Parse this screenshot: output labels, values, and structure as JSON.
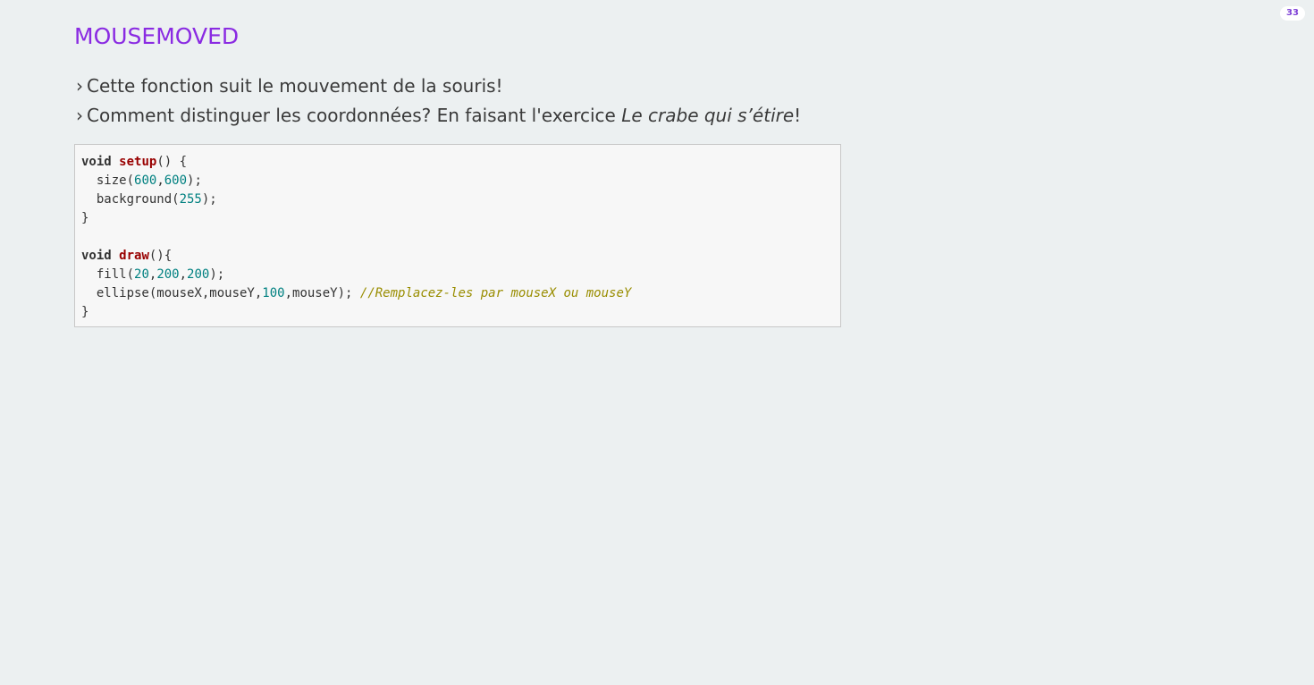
{
  "slide": {
    "page_number": "33",
    "title": "MOUSEMOVED",
    "bullets": [
      {
        "marker": "›",
        "text": "Cette fonction suit le mouvement de la souris!"
      },
      {
        "marker": "›",
        "text_before": "Comment distinguer les coordonnées? En faisant l'exercice ",
        "text_emphasis": "Le crabe qui s’étire",
        "text_after": "!"
      }
    ]
  },
  "code": {
    "l1_kw": "void",
    "l1_fn": "setup",
    "l1_rest": "() {",
    "l2_a": "  size(",
    "l2_n1": "600",
    "l2_b": ",",
    "l2_n2": "600",
    "l2_c": ");",
    "l3_a": "  background(",
    "l3_n1": "255",
    "l3_b": ");",
    "l4": "}",
    "l6_kw": "void",
    "l6_fn": "draw",
    "l6_rest": "(){",
    "l7_a": "  fill(",
    "l7_n1": "20",
    "l7_b": ",",
    "l7_n2": "200",
    "l7_c": ",",
    "l7_n3": "200",
    "l7_d": ");",
    "l8_a": "  ellipse(mouseX,mouseY,",
    "l8_n1": "100",
    "l8_b": ",mouseY); ",
    "l8_comment": "//Remplacez-les par mouseX ou mouseY",
    "l9": "}"
  },
  "colors": {
    "background": "#ecf0f1",
    "title": "#8a2be2",
    "keyword_function": "#990000",
    "number": "#008080",
    "comment": "#998d00"
  }
}
